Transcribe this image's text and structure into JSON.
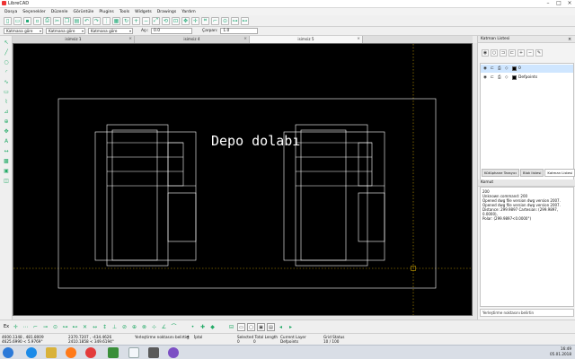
{
  "window": {
    "title": "LibreCAD"
  },
  "menu": [
    "Dosya",
    "Seçenekler",
    "Düzenle",
    "Görüntüle",
    "Plugins",
    "Tools",
    "Widgets",
    "Drawings",
    "Yardım"
  ],
  "options_toolbar": {
    "pen_combo_1": "Katmana göre",
    "pen_combo_2": "Katmana göre",
    "pen_combo_3": "Katmana göre",
    "angle_label": "Açı:",
    "angle_value": "0.0",
    "factor_label": "Çarpan:",
    "factor_value": "1.0"
  },
  "tabs": [
    {
      "label": "isimsiz 1",
      "active": false
    },
    {
      "label": "isimsiz 4",
      "active": false
    },
    {
      "label": "isimsiz 5",
      "active": true
    }
  ],
  "drawing": {
    "text": "Depo dolabı"
  },
  "layer_panel": {
    "title": "Katman Listesi",
    "layers": [
      {
        "name": "0",
        "selected": true
      },
      {
        "name": "Defpoints",
        "selected": false
      }
    ]
  },
  "dock_tabs": [
    "Kütüphane Tarayıcı",
    "Blok listesi",
    "Katman Listesi"
  ],
  "command_panel": {
    "title": "Komut",
    "log": [
      "200",
      "Unknown command: 200",
      "Opened dwg file version dwg version 2007.",
      "Opened dwg file version dwg version 2007.",
      "Distance: 299.9897 Cartesian: (299.9897, 0.0000),",
      "Polar: (299.9897<0.0000°)"
    ],
    "prompt": "Yerleştirme noktasını belirtin"
  },
  "status": {
    "command_prefix": "Ex",
    "abs_coords_1": "4600.1348 , 481.8009",
    "abs_coords_2": "4625.6990 < 5.9769°",
    "rel_coords_1": "2370.7207 , -434.4626",
    "rel_coords_2": "2410.1858 < 349.6194°",
    "prompt_left": "Yerleştirme noktasını belirtin",
    "prompt_right": "İptal",
    "selected_total_length_label": "Selected Total Length",
    "selected_total_length_value": "0",
    "selected_count": "0",
    "current_layer_label": "Current Layer",
    "current_layer_value": "Defpoints",
    "grid_status_label": "Grid Status",
    "grid_status_value": "10 / 100"
  },
  "taskbar": {
    "time": "16:49",
    "date": "05.01.2018"
  },
  "colors": {
    "canvas": "#000000",
    "entity": "#ffffff",
    "guide": "#c8a000"
  }
}
